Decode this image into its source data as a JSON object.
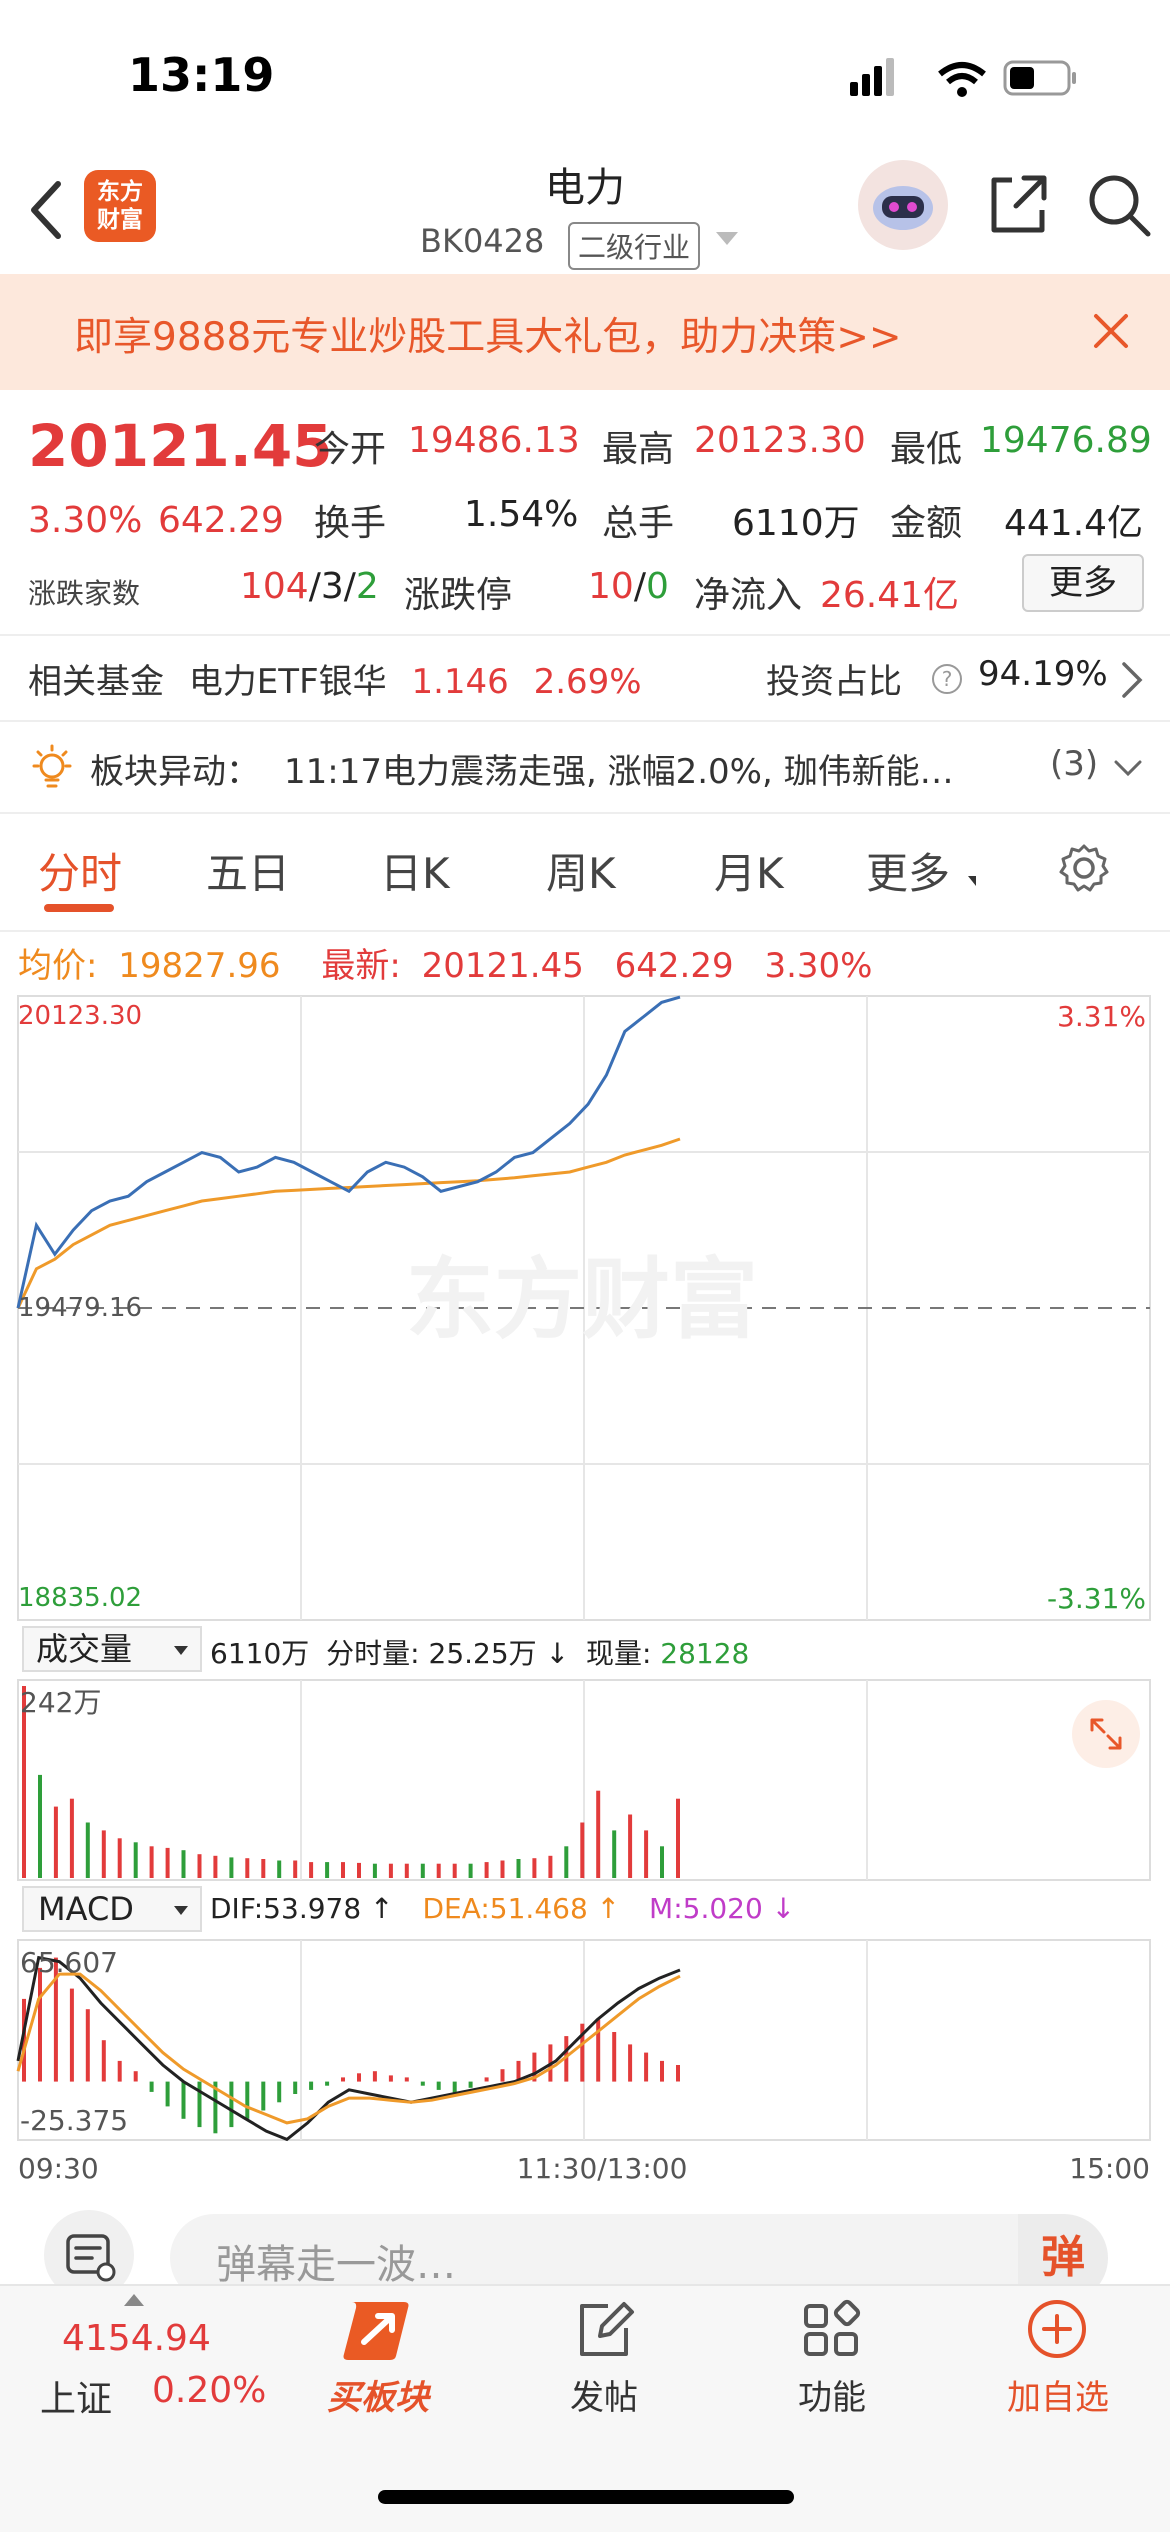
{
  "status_bar": {
    "time": "13:19"
  },
  "header": {
    "title": "电力",
    "code": "BK0428",
    "level_tag": "二级行业",
    "logo_line1": "东方",
    "logo_line2": "财富"
  },
  "promo": {
    "text": "即享9888元专业炒股工具大礼包，助力决策>>"
  },
  "quote": {
    "price": "20121.45",
    "change_pct": "3.30%",
    "change": "642.29",
    "open_label": "今开",
    "open": "19486.13",
    "high_label": "最高",
    "high": "20123.30",
    "low_label": "最低",
    "low": "19476.89",
    "turnover_label": "换手",
    "turnover": "1.54%",
    "volume_label": "总手",
    "volume": "6110万",
    "amount_label": "金额",
    "amount": "441.4亿",
    "advdec_label": "涨跌家数",
    "adv": "104",
    "flat": "3",
    "dec": "2",
    "limit_label": "涨跌停",
    "limit_up": "10",
    "limit_down": "0",
    "netflow_label": "净流入",
    "netflow": "26.41亿",
    "more_label": "更多"
  },
  "fund": {
    "label": "相关基金",
    "name": "电力ETF银华",
    "price": "1.146",
    "pct": "2.69%",
    "ratio_label": "投资占比",
    "ratio": "94.19%"
  },
  "alert": {
    "label": "板块异动：",
    "text": "11:17电力震荡走强, 涨幅2.0%, 珈伟新能…",
    "count": "(3)"
  },
  "tabs": [
    "分时",
    "五日",
    "日K",
    "周K",
    "月K",
    "更多"
  ],
  "chart_header": {
    "avg_label": "均价:",
    "avg": "19827.96",
    "latest_label": "最新:",
    "latest": "20121.45",
    "latest_change": "642.29",
    "latest_pct": "3.30%"
  },
  "volume_header": {
    "selector": "成交量",
    "total": "6110万",
    "minute_label": "分时量:",
    "minute": "25.25万 ↓",
    "current_label": "现量:",
    "current": "28128"
  },
  "macd_header": {
    "selector": "MACD",
    "dif": "DIF:53.978 ↑",
    "dea": "DEA:51.468 ↑",
    "m": "M:5.020 ↓"
  },
  "colors": {
    "up": "#e23b3b",
    "down": "#2e9e3a",
    "price_line": "#3a6fb5",
    "avg_line": "#ef9a2a",
    "accent": "#e5522a"
  },
  "chart_data": {
    "type": "line",
    "price_axis": {
      "max": "20123.30",
      "mid": "19479.16",
      "min": "18835.02"
    },
    "pct_axis": {
      "max": "3.31%",
      "min": "-3.31%"
    },
    "volume_axis": {
      "max": "242万"
    },
    "macd_axis": {
      "max": "65.607",
      "min": "-25.375"
    },
    "time_labels": [
      "09:30",
      "11:30/13:00",
      "15:00"
    ],
    "ylim": [
      18835.02,
      20123.3
    ],
    "prev_close": 19479.16,
    "series": [
      {
        "name": "最新",
        "values": [
          19479,
          19650,
          19590,
          19640,
          19680,
          19700,
          19710,
          19740,
          19760,
          19780,
          19800,
          19790,
          19760,
          19770,
          19790,
          19780,
          19760,
          19740,
          19720,
          19760,
          19780,
          19770,
          19750,
          19720,
          19730,
          19740,
          19760,
          19790,
          19800,
          19830,
          19860,
          19900,
          19960,
          20050,
          20080,
          20110,
          20121
        ]
      },
      {
        "name": "均价",
        "values": [
          19479,
          19560,
          19580,
          19610,
          19630,
          19650,
          19660,
          19670,
          19680,
          19690,
          19700,
          19705,
          19710,
          19715,
          19720,
          19722,
          19724,
          19726,
          19728,
          19730,
          19732,
          19734,
          19736,
          19738,
          19740,
          19742,
          19745,
          19748,
          19752,
          19756,
          19760,
          19770,
          19780,
          19795,
          19805,
          19815,
          19828
        ]
      }
    ],
    "volume_values": [
      242,
      130,
      90,
      100,
      70,
      60,
      50,
      45,
      40,
      38,
      35,
      30,
      28,
      26,
      25,
      24,
      22,
      22,
      20,
      20,
      20,
      19,
      18,
      18,
      18,
      18,
      18,
      18,
      18,
      20,
      22,
      24,
      25,
      28,
      40,
      70,
      110,
      60,
      80,
      60,
      40,
      100
    ],
    "macd_values": [
      40,
      55,
      60,
      45,
      35,
      20,
      10,
      5,
      -5,
      -12,
      -18,
      -22,
      -25,
      -22,
      -18,
      -14,
      -10,
      -6,
      -4,
      -2,
      2,
      4,
      5,
      3,
      2,
      -2,
      -4,
      -6,
      -3,
      2,
      6,
      10,
      14,
      18,
      22,
      28,
      30,
      24,
      18,
      14,
      10,
      8
    ],
    "dif_values": [
      10,
      60,
      58,
      50,
      38,
      28,
      18,
      8,
      0,
      -6,
      -12,
      -18,
      -24,
      -28,
      -20,
      -10,
      -4,
      -6,
      -8,
      -10,
      -8,
      -6,
      -4,
      -2,
      0,
      4,
      10,
      20,
      30,
      38,
      45,
      50,
      54
    ],
    "dea_values": [
      5,
      40,
      52,
      52,
      44,
      34,
      24,
      14,
      6,
      0,
      -6,
      -12,
      -16,
      -20,
      -18,
      -12,
      -8,
      -8,
      -9,
      -10,
      -9,
      -7,
      -5,
      -3,
      -1,
      2,
      8,
      16,
      24,
      32,
      40,
      46,
      51
    ]
  },
  "danmu": {
    "placeholder": "弹幕走一波…",
    "toggle": "弹"
  },
  "bottom_nav": {
    "index_value": "4154.94",
    "index_name": "上证",
    "index_pct": "0.20%",
    "buy_label": "买板块",
    "post_label": "发帖",
    "func_label": "功能",
    "watch_label": "加自选"
  }
}
